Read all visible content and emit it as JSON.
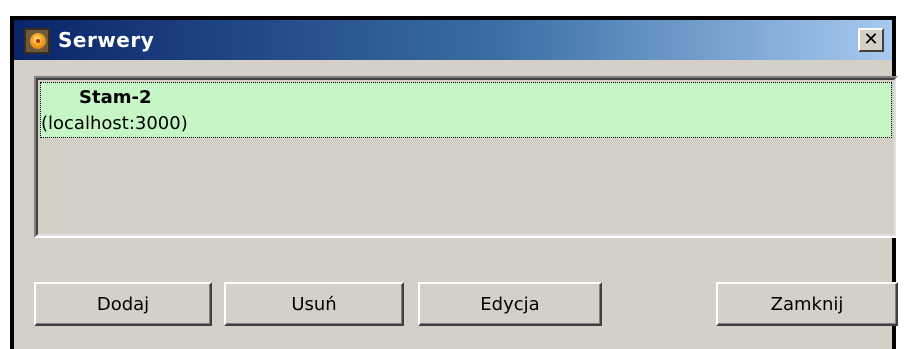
{
  "window": {
    "title": "Serwery",
    "close_symbol": "✕",
    "app_icon": "server-dial-icon"
  },
  "server_list": {
    "items": [
      {
        "name": "Stam-2",
        "address": "(localhost:3000)"
      }
    ],
    "selected_color": "#c6f6c6"
  },
  "buttons": {
    "add": "Dodaj",
    "remove": "Usuń",
    "edit": "Edycja",
    "close": "Zamknij"
  }
}
